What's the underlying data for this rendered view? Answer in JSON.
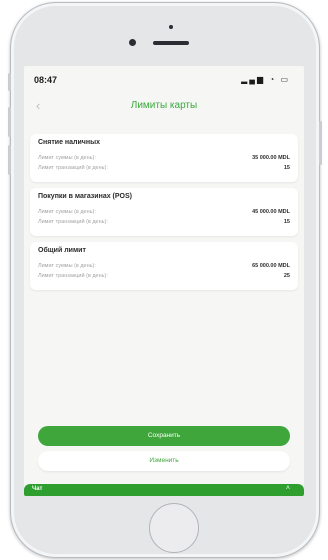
{
  "status_bar": {
    "time": "08:47",
    "icons": "signal wifi battery"
  },
  "header": {
    "back_icon": "chevron-left-icon",
    "title": "Лимиты карты"
  },
  "cards": [
    {
      "title": "Снятие наличных",
      "rows": [
        {
          "label": "Лимит суммы (в день):",
          "value": "35 000.00 MDL"
        },
        {
          "label": "Лимит транзакций (в день):",
          "value": "15"
        }
      ]
    },
    {
      "title": "Покупки в магазинах (POS)",
      "rows": [
        {
          "label": "Лимит суммы (в день):",
          "value": "45 000.00 MDL"
        },
        {
          "label": "Лимит транзакций (в день):",
          "value": "15"
        }
      ]
    },
    {
      "title": "Общий лимит",
      "rows": [
        {
          "label": "Лимит суммы (в день):",
          "value": "65 000.00 MDL"
        },
        {
          "label": "Лимит транзакций (в день):",
          "value": "25"
        }
      ]
    }
  ],
  "actions": {
    "save": "Сохранить",
    "edit": "Изменить"
  },
  "chat": {
    "label": "Чат",
    "toggle_icon": "chevron-up-icon"
  },
  "colors": {
    "accent": "#3ea63b",
    "background": "#f6f7f5",
    "card": "#ffffff"
  }
}
